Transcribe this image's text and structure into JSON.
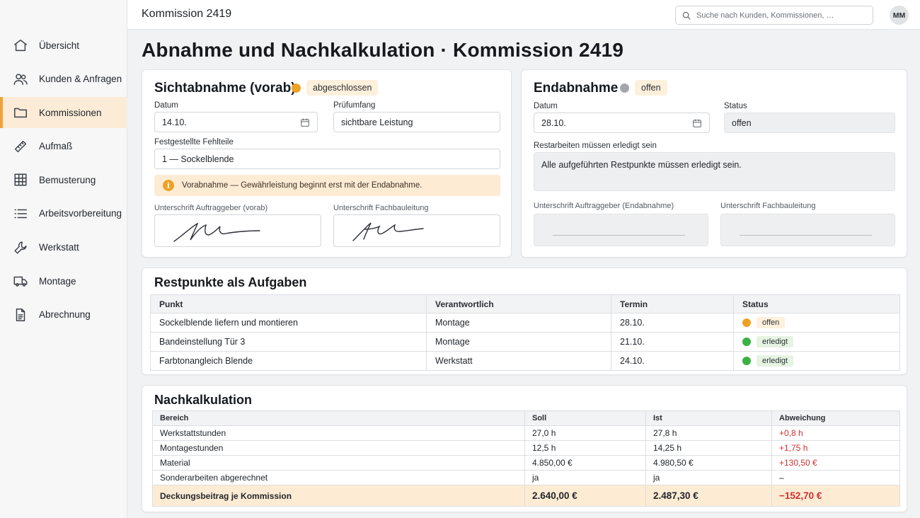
{
  "colors": {
    "accent": "#f0a33a",
    "status_open": "#eda225",
    "status_pending": "#a3a6ab",
    "status_done": "#3cb043",
    "deviation": "#d32f2f"
  },
  "header": {
    "app_title": "Kommission 2419",
    "search_placeholder": "Suche nach Kunden, Kommissionen, …",
    "avatar_initials": "MM"
  },
  "sidebar": {
    "items": [
      {
        "label": "Übersicht",
        "icon": "home-icon"
      },
      {
        "label": "Kunden & Anfragen",
        "icon": "users-icon"
      },
      {
        "label": "Kommissionen",
        "icon": "folder-icon",
        "active": true
      },
      {
        "label": "Aufmaß",
        "icon": "ruler-icon"
      },
      {
        "label": "Bemusterung",
        "icon": "grid-icon"
      },
      {
        "label": "Arbeitsvorbereitung",
        "icon": "list-icon"
      },
      {
        "label": "Werkstatt",
        "icon": "wrench-icon"
      },
      {
        "label": "Montage",
        "icon": "truck-icon"
      },
      {
        "label": "Abrechnung",
        "icon": "document-icon"
      }
    ]
  },
  "page_title": "Abnahme und Nachkalkulation · Kommission 2419",
  "preliminary": {
    "title": "Sichtabnahme (vorab)",
    "status": "abgeschlossen",
    "date_label": "Datum",
    "date_value": "14.10.",
    "scope_label": "Prüfumfang",
    "scope_value": "sichtbare Leistung",
    "defects_label": "Festgestellte Fehlteile",
    "defects_value": "1 — Sockelblende",
    "note": "Vorabnahme — Gewährleistung beginnt erst mit der Endabnahme.",
    "sig_client_label": "Unterschrift Auftraggeber (vorab)",
    "sig_site_label": "Unterschrift Fachbauleitung"
  },
  "final": {
    "title": "Endabnahme",
    "status": "offen",
    "date_label": "Datum",
    "date_value": "28.10.",
    "status_label": "Status",
    "status_value": "offen",
    "remaining_label": "Restarbeiten müssen erledigt sein",
    "remaining_value": "Alle aufgeführten Restpunkte müssen erledigt sein.",
    "sig_client_label": "Unterschrift Auftraggeber (Endabnahme)",
    "sig_site_label": "Unterschrift Fachbauleitung"
  },
  "tasks": {
    "title": "Restpunkte als Aufgaben",
    "columns": [
      "Punkt",
      "Verantwortlich",
      "Termin",
      "Status"
    ],
    "rows": [
      {
        "point": "Sockelblende liefern und montieren",
        "owner": "Montage",
        "date": "28.10.",
        "status": "offen"
      },
      {
        "point": "Bandeinstellung Tür 3",
        "owner": "Montage",
        "date": "21.10.",
        "status": "erledigt"
      },
      {
        "point": "Farbtonangleich Blende",
        "owner": "Werkstatt",
        "date": "24.10.",
        "status": "erledigt"
      }
    ]
  },
  "calc": {
    "title": "Nachkalkulation",
    "columns": [
      "Bereich",
      "Soll",
      "Ist",
      "Abweichung"
    ],
    "rows": [
      {
        "area": "Werkstattstunden",
        "plan": "27,0 h",
        "actual": "27,8 h",
        "diff": "+0,8 h"
      },
      {
        "area": "Montagestunden",
        "plan": "12,5 h",
        "actual": "14,25 h",
        "diff": "+1,75 h"
      },
      {
        "area": "Material",
        "plan": "4.850,00 €",
        "actual": "4.980,50 €",
        "diff": "+130,50 €"
      },
      {
        "area": "Sonderarbeiten abgerechnet",
        "plan": "ja",
        "actual": "ja",
        "diff": "–"
      }
    ],
    "total": {
      "area": "Deckungsbeitrag je Kommission",
      "plan": "2.640,00 €",
      "actual": "2.487,30 €",
      "diff": "−152,70 €"
    }
  }
}
